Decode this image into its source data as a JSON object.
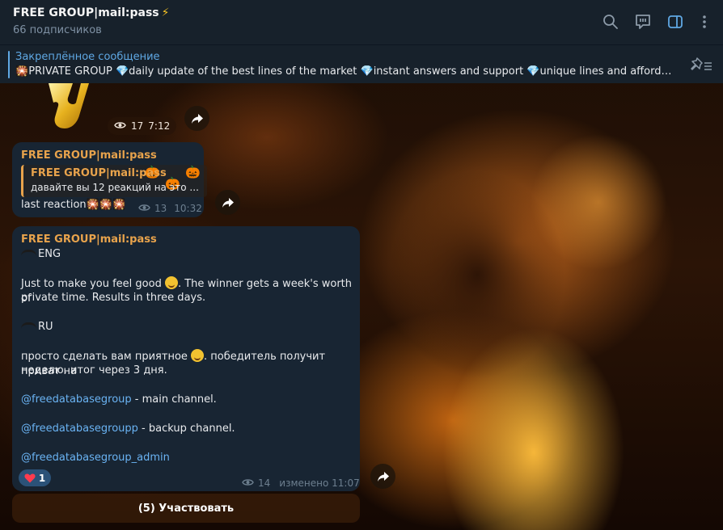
{
  "header": {
    "title": "FREE GROUP|mail:pass",
    "bolt": "⚡",
    "subtitle": "66 подписчиков",
    "icons": [
      "search-icon",
      "discussion-icon",
      "sidebar-toggle-icon",
      "more-vert-icon"
    ]
  },
  "pinned": {
    "title": "Закреплённое сообщение",
    "firework": "🎇",
    "gem": "💎",
    "seg1": "PRIVATE GROUP ",
    "seg2": "daily update of the best lines of the market ",
    "seg3": "instant answers and support ",
    "seg4": "unique lines and affordable pri..."
  },
  "sticker_message": {
    "views": "17",
    "time": "7:12"
  },
  "message1": {
    "author": "FREE GROUP|mail:pass",
    "reply_author": "FREE GROUP|mail:pass",
    "reply_text": "давайте вы 12 реакций на это ...",
    "text": "last reaction",
    "fireworks": "🎇🎇🎇",
    "views": "13",
    "time": "10:32"
  },
  "message2": {
    "author": "FREE GROUP|mail:pass",
    "eng_label": "ENG",
    "eng_text_a": "Just to make you feel good ",
    "eng_text_b": ". The winner gets a week's worth of",
    "eng_text_c": "private time. Results in three days.",
    "ru_label": "RU",
    "ru_text_a": "просто сделать вам приятное ",
    "ru_text_b": ". победитель получит приват на",
    "ru_text_c": "неделю. итог через 3 дня.",
    "link1": "@freedatabasegroup",
    "link1_suffix": " - main channel.",
    "link2": "@freedatabasegroupp",
    "link2_suffix": " - backup channel.",
    "link3": "@freedatabasegroup_admin",
    "reaction_count": "1",
    "views": "14",
    "edited_time": "изменено 11:07",
    "button_label": "(5) Участвовать"
  }
}
